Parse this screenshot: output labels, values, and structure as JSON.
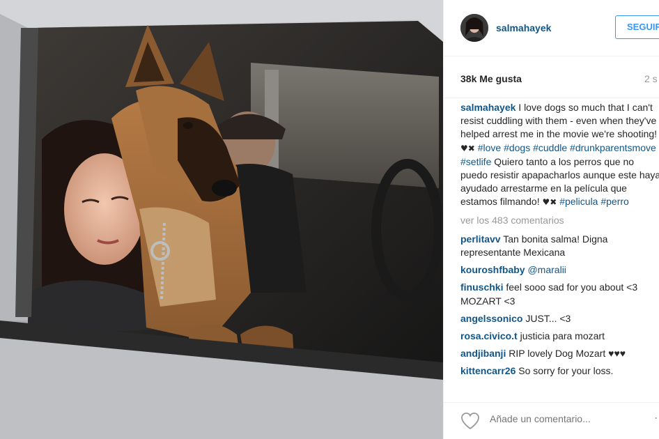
{
  "header": {
    "username": "salmahayek",
    "follow_label": "SEGUIR"
  },
  "stats": {
    "likes": "38k Me gusta",
    "time_ago": "2 s"
  },
  "caption": {
    "username": "salmahayek",
    "text_en": " I love dogs so much that I can't resist cuddling with them - even when they've helped arrest me in the movie we're shooting! ",
    "emoji": "♥✖",
    "tags_en": [
      "#love",
      "#dogs",
      "#cuddle",
      "#drunkparentsmove",
      "#setlife"
    ],
    "text_es": "Quiero tanto a los perros que no puedo resistir apapacharlos aunque este haya ayudado arrestarme en la película que estamos filmando! ",
    "tags_es": [
      "#pelicula",
      "#perro"
    ]
  },
  "view_more": "ver los 483 comentarios",
  "comments": [
    {
      "user": "perlitavv",
      "text": "Tan bonita salma! Digna representante Mexicana"
    },
    {
      "user": "kouroshfbaby",
      "text": "@maralii"
    },
    {
      "user": "finuschki",
      "text": "feel sooo sad for you about <3 MOZART <3"
    },
    {
      "user": "angelssonico",
      "text": "JUST... <3"
    },
    {
      "user": "rosa.civico.t",
      "text": "justicia para mozart"
    },
    {
      "user": "andjibanji",
      "text": "RIP lovely Dog Mozart ♥♥♥"
    },
    {
      "user": "kittencarr26",
      "text": "So sorry for your loss."
    }
  ],
  "footer": {
    "add_comment_placeholder": "Añade un comentario..."
  },
  "colors": {
    "link": "#125688",
    "follow": "#3897f0",
    "muted": "#999999"
  }
}
